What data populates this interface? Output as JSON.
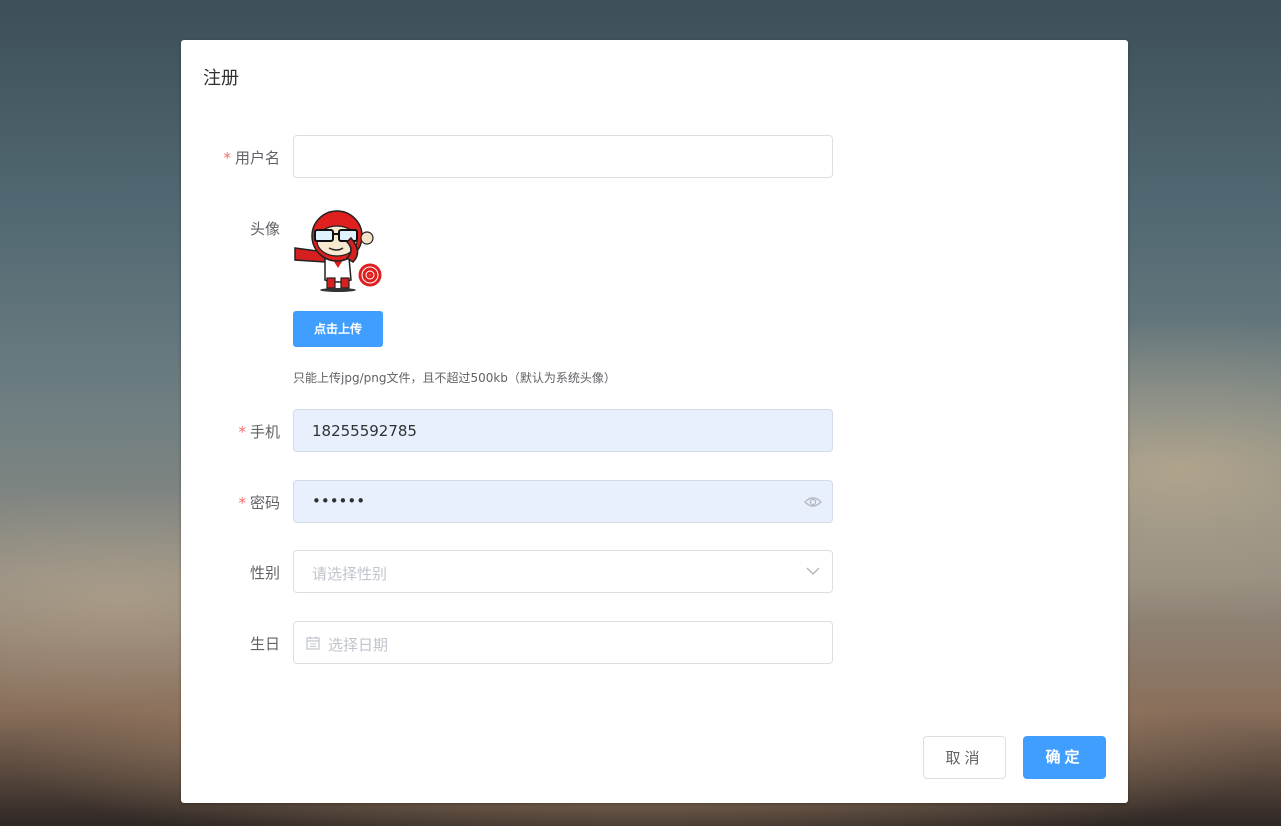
{
  "dialog": {
    "title": "注册",
    "required_mark": "*",
    "fields": {
      "username": {
        "label": "用户名",
        "value": ""
      },
      "avatar": {
        "label": "头像",
        "upload_button": "点击上传",
        "tip": "只能上传jpg/png文件，且不超过500kb（默认为系统头像）"
      },
      "phone": {
        "label": "手机",
        "value": "18255592785"
      },
      "password": {
        "label": "密码",
        "value": "••••••"
      },
      "gender": {
        "label": "性别",
        "placeholder": "请选择性别"
      },
      "birthday": {
        "label": "生日",
        "placeholder": "选择日期"
      }
    },
    "buttons": {
      "cancel": "取消",
      "confirm": "确定"
    }
  },
  "colors": {
    "primary": "#409eff",
    "required": "#f56c6c",
    "autofill_bg": "#e8f0fe"
  },
  "icons": [
    "monkey-avatar",
    "eye-icon",
    "chevron-down-icon",
    "calendar-icon"
  ]
}
